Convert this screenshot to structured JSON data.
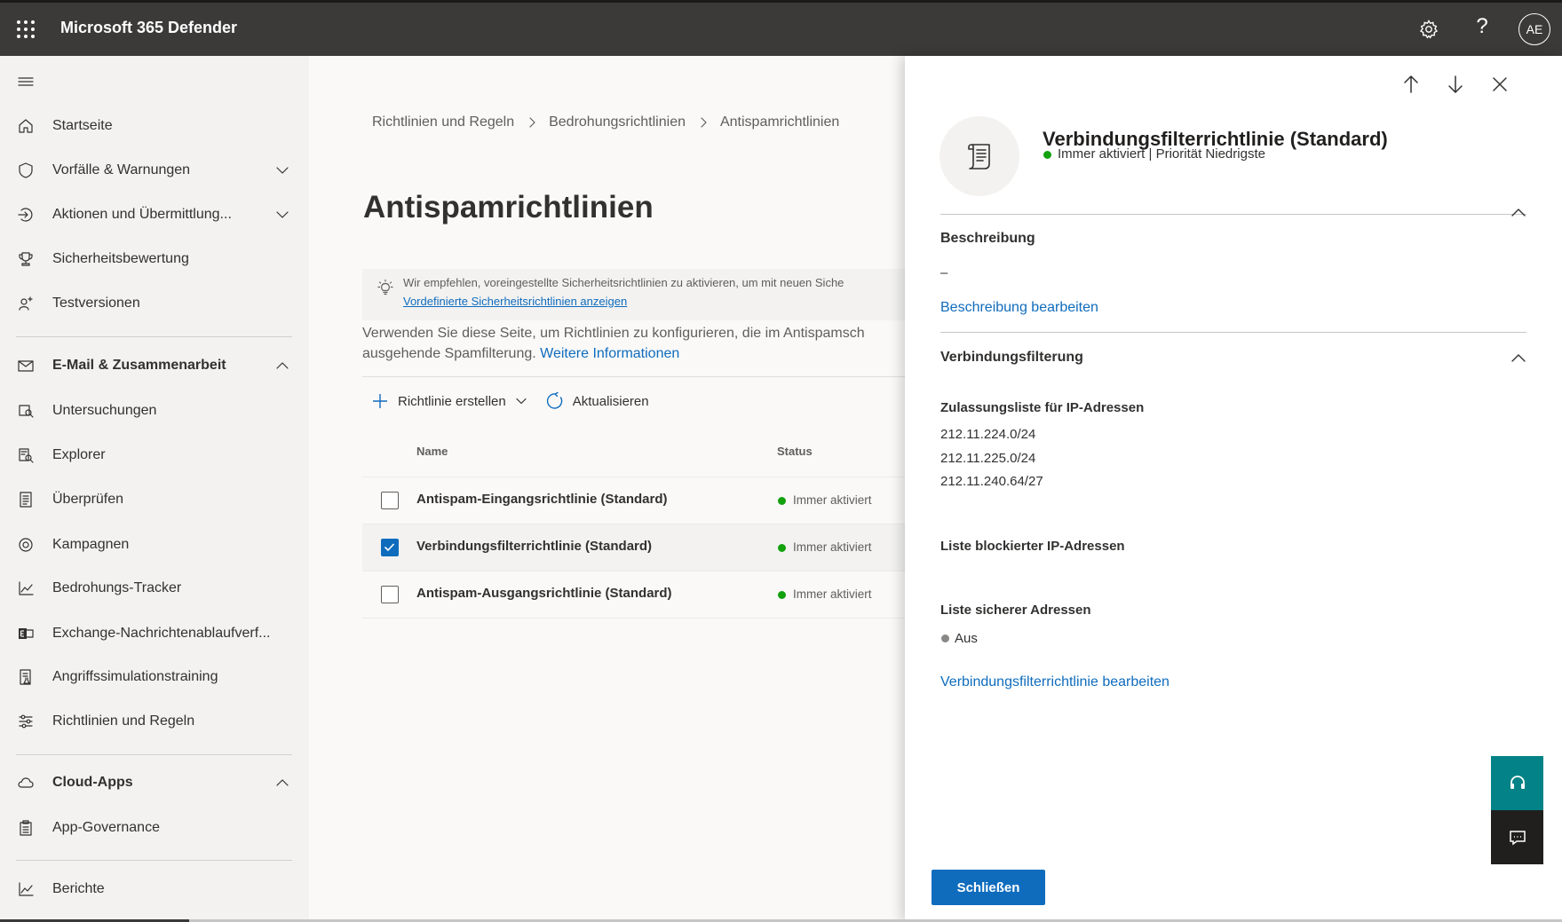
{
  "topbar": {
    "app_title": "Microsoft 365 Defender",
    "avatar_initials": "AE",
    "icons": [
      "app-launcher-icon",
      "settings-gear-icon",
      "help-icon"
    ],
    "help_glyph": "?"
  },
  "nav": {
    "items": [
      {
        "label": "Startseite",
        "icon": "home-icon"
      },
      {
        "label": "Vorfälle & Warnungen",
        "icon": "shield-icon"
      },
      {
        "label": "Aktionen und Übermittlung...",
        "icon": "actions-icon"
      },
      {
        "label": "Sicherheitsbewertung",
        "icon": "trophy-icon"
      },
      {
        "label": "Testversionen",
        "icon": "trials-icon"
      },
      {
        "label": "E-Mail & Zusammenarbeit",
        "icon": "mail-icon"
      },
      {
        "label": "Untersuchungen",
        "icon": "investigation-icon"
      },
      {
        "label": "Explorer",
        "icon": "explorer-icon"
      },
      {
        "label": "Überprüfen",
        "icon": "review-icon"
      },
      {
        "label": "Kampagnen",
        "icon": "campaign-icon"
      },
      {
        "label": "Bedrohungs-Tracker",
        "icon": "threat-tracker-icon"
      },
      {
        "label": "Exchange-Nachrichtenablaufverf...",
        "icon": "exchange-icon"
      },
      {
        "label": "Angriffssimulationstraining",
        "icon": "simulation-icon"
      },
      {
        "label": "Richtlinien und Regeln",
        "icon": "policy-sliders-icon"
      },
      {
        "label": "Cloud-Apps",
        "icon": "cloud-icon"
      },
      {
        "label": "App-Governance",
        "icon": "clipboard-icon"
      },
      {
        "label": "Berichte",
        "icon": "reports-chart-icon"
      }
    ]
  },
  "main": {
    "breadcrumb": [
      "Richtlinien und Regeln",
      "Bedrohungsrichtlinien",
      "Antispamrichtlinien"
    ],
    "page_title": "Antispamrichtlinien",
    "info": {
      "text": "Wir empfehlen, voreingestellte Sicherheitsrichtlinien zu aktivieren, um mit neuen Siche",
      "link": "Vordefinierte Sicherheitsrichtlinien anzeigen"
    },
    "description": {
      "line1": "Verwenden Sie diese Seite, um Richtlinien zu konfigurieren, die im Antispamsch",
      "line2": "ausgehende Spamfilterung.",
      "link": "Weitere Informationen"
    },
    "toolbar": {
      "create_label": "Richtlinie erstellen",
      "refresh_label": "Aktualisieren"
    },
    "table": {
      "columns": [
        "Name",
        "Status"
      ],
      "rows": [
        {
          "name": "Antispam-Eingangsrichtlinie (Standard)",
          "status": "Immer aktiviert",
          "checked": false
        },
        {
          "name": "Verbindungsfilterrichtlinie (Standard)",
          "status": "Immer aktiviert",
          "checked": true
        },
        {
          "name": "Antispam-Ausgangsrichtlinie (Standard)",
          "status": "Immer aktiviert",
          "checked": false
        }
      ]
    }
  },
  "panel": {
    "title": "Verbindungsfilterrichtlinie (Standard)",
    "status": "Immer aktiviert | Priorität Niedrigste",
    "description_section": {
      "heading": "Beschreibung",
      "value": "–",
      "edit_link": "Beschreibung bearbeiten"
    },
    "connection_section": {
      "heading": "Verbindungsfilterung",
      "allow_list_label": "Zulassungsliste für IP-Adressen",
      "allow_list": [
        "212.11.224.0/24",
        "212.11.225.0/24",
        "212.11.240.64/27"
      ],
      "block_list_label": "Liste blockierter IP-Adressen",
      "safe_list_label": "Liste sicherer Adressen",
      "safe_list_value": "Aus",
      "edit_link": "Verbindungsfilterrichtlinie bearbeiten"
    },
    "close_button": "Schließen"
  },
  "colors": {
    "topbar": "#3b3a39",
    "nav_bg": "#f3f2f1",
    "accent": "#0f6cbd",
    "status_on": "#13a10e",
    "status_off": "#8a8886",
    "help_button": "#038387"
  }
}
